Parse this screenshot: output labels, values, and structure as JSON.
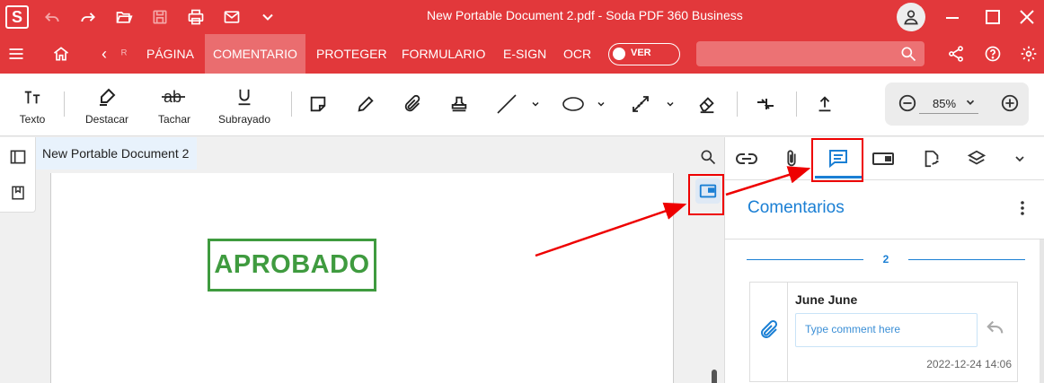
{
  "app": {
    "logo_letter": "S",
    "window_title": "New Portable Document 2.pdf   -   Soda PDF 360 Business"
  },
  "menu": {
    "items": [
      {
        "label": "‹"
      },
      {
        "label": "ᴿ"
      },
      {
        "label": "PÁGINA"
      },
      {
        "label": "COMENTARIO",
        "active": true
      },
      {
        "label": "PROTEGER"
      },
      {
        "label": "FORMULARIO"
      },
      {
        "label": "E-SIGN"
      },
      {
        "label": "OCR"
      }
    ],
    "view_toggle_label": "VER",
    "search_placeholder": ""
  },
  "toolbar": {
    "tools": [
      "Texto",
      "Destacar",
      "Tachar",
      "Subrayado"
    ],
    "zoom": "85%"
  },
  "document": {
    "tab_title": "New Portable Document 2",
    "stamp_text": "APROBADO",
    "stamp_color": "#3f9b3f"
  },
  "panel": {
    "title": "Comentarios",
    "comment_count": "2",
    "comment": {
      "author": "June June",
      "input_placeholder": "Type comment here",
      "timestamp": "2022-12-24 14:06"
    }
  },
  "colors": {
    "brand_red": "#e2383b",
    "accent_blue": "#1a7fd4",
    "annotation_red": "#e00000"
  }
}
